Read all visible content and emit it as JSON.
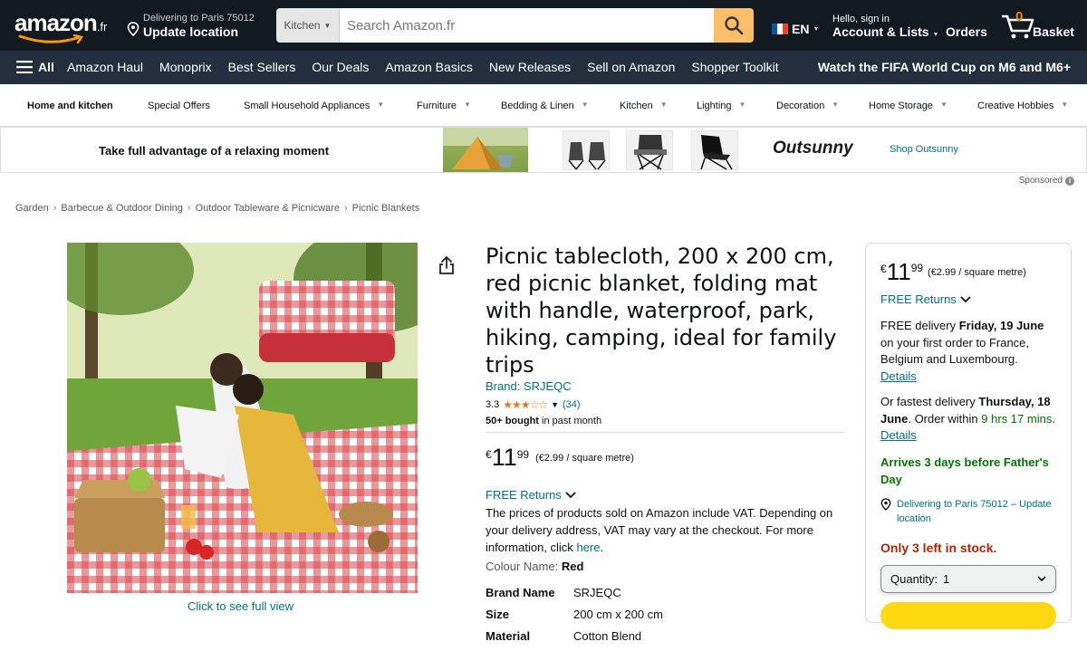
{
  "header": {
    "logo_word": "amazon",
    "logo_tld": ".fr",
    "deliver_line1": "Delivering to Paris 75012",
    "deliver_line2": "Update location",
    "search_category": "Kitchen",
    "search_placeholder": "Search Amazon.fr",
    "language": "EN",
    "account_line1": "Hello, sign in",
    "account_line2": "Account & Lists",
    "orders": "Orders",
    "basket_count": "0",
    "basket_label": "Basket"
  },
  "nav": {
    "all_label": "All",
    "items": [
      "Amazon Haul",
      "Monoprix",
      "Best Sellers",
      "Our Deals",
      "Amazon Basics",
      "New Releases",
      "Sell on Amazon",
      "Shopper Toolkit"
    ],
    "promo": "Watch the FIFA World Cup on M6 and M6+"
  },
  "subnav": [
    "Home and kitchen",
    "Special Offers",
    "Small Household Appliances",
    "Furniture",
    "Bedding & Linen",
    "Kitchen",
    "Lighting",
    "Decoration",
    "Home Storage",
    "Creative Hobbies"
  ],
  "banner": {
    "headline": "Take full advantage of a relaxing moment",
    "brand_logo": "Outsunny",
    "cta": "Shop Outsunny",
    "sponsored": "Sponsored"
  },
  "breadcrumb": [
    "Garden",
    "Barbecue & Outdoor Dining",
    "Outdoor Tableware & Picnicware",
    "Picnic Blankets"
  ],
  "product": {
    "title": "Picnic tablecloth, 200 x 200 cm, red picnic blanket, folding mat with handle, waterproof, park, hiking, camping, ideal for family trips",
    "brand": "Brand: SRJEQC",
    "rating": "3.3",
    "stars_display": "★★★☆☆",
    "rating_count": "(34)",
    "bought_bold": "50+ bought",
    "bought_rest": "in past month",
    "currency": "€",
    "price_whole": "11",
    "price_fraction": "99",
    "unit_price": "(€2.99 / square metre)",
    "returns": "FREE Returns",
    "vat_text": "The prices of products sold on Amazon include VAT. Depending on your delivery address, VAT may vary at the checkout. For more information, click",
    "vat_link": "here",
    "colour_label": "Colour Name:",
    "colour_value": "Red",
    "specs": [
      {
        "key": "Brand Name",
        "value": "SRJEQC"
      },
      {
        "key": "Size",
        "value": "200 cm x 200 cm"
      },
      {
        "key": "Material",
        "value": "Cotton Blend"
      }
    ],
    "full_view": "Click to see full view"
  },
  "buybox": {
    "currency": "€",
    "price_whole": "11",
    "price_fraction": "99",
    "unit_price": "(€2.99 / square metre)",
    "returns": "FREE Returns",
    "delivery_pre": "FREE delivery",
    "delivery_date": "Friday, 19 June",
    "delivery_post": "on your first order to France, Belgium and Luxembourg.",
    "details": "Details",
    "fast_pre": "Or fastest delivery",
    "fast_date": "Thursday, 18 June",
    "fast_mid": ". Order within",
    "fast_time": "9 hrs 17 mins",
    "arrives": "Arrives 3 days before Father's Day",
    "location": "Delivering to Paris 75012 – Update location",
    "stock": "Only 3 left in stock.",
    "qty_label": "Quantity:",
    "qty_value": "1"
  },
  "colors": {
    "nav_dark": "#131921",
    "nav_secondary": "#232f3e",
    "accent_orange": "#febd69",
    "link": "#007185",
    "price_red": "#b12704",
    "green": "#007600",
    "star": "#de7921"
  }
}
